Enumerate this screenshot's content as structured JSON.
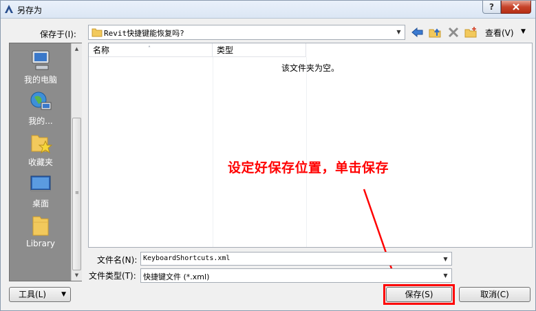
{
  "window": {
    "title": "另存为",
    "help_label": "?"
  },
  "save_in": {
    "label": "保存于(I):",
    "value": "Revit快捷键能恢复吗?"
  },
  "toolbar": {
    "view_label": "查看(V)",
    "icons": [
      "back-arrow-icon",
      "up-folder-icon",
      "delete-icon",
      "new-folder-icon"
    ]
  },
  "places": [
    {
      "label": "我的电脑",
      "icon": "my-computer-icon"
    },
    {
      "label": "我的...",
      "icon": "network-icon"
    },
    {
      "label": "收藏夹",
      "icon": "favorites-icon"
    },
    {
      "label": "桌面",
      "icon": "desktop-icon"
    },
    {
      "label": "Library",
      "icon": "library-folder-icon"
    }
  ],
  "file_list": {
    "columns": [
      "名称",
      "类型"
    ],
    "empty_message": "该文件夹为空。"
  },
  "annotation": {
    "text": "设定好保存位置，单击保存",
    "color": "#ff0000"
  },
  "file_name": {
    "label": "文件名(N):",
    "value": "KeyboardShortcuts.xml"
  },
  "file_type": {
    "label": "文件类型(T):",
    "value": "快捷键文件 (*.xml)"
  },
  "buttons": {
    "tools": "工具(L)",
    "save": "保存(S)",
    "cancel": "取消(C)"
  }
}
